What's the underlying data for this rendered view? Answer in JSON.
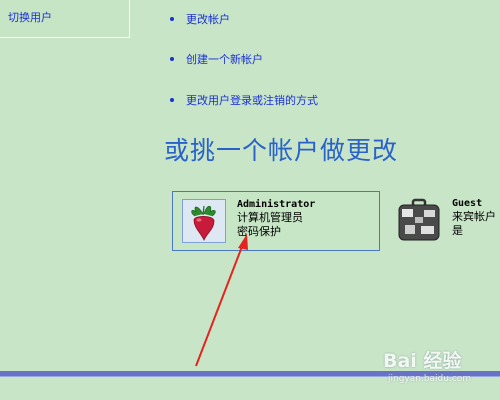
{
  "sidebar": {
    "switch_user": "切换用户"
  },
  "tasks": [
    {
      "label": "更改帐户"
    },
    {
      "label": "创建一个新帐户"
    },
    {
      "label": "更改用户登录或注销的方式"
    }
  ],
  "section": {
    "title": "或挑一个帐户做更改"
  },
  "accounts": {
    "admin": {
      "name": "Administrator",
      "type": "计算机管理员",
      "status": "密码保护",
      "icon": "radish-icon"
    },
    "guest": {
      "name": "Guest",
      "type": "来宾帐户是",
      "icon": "suitcase-icon"
    }
  },
  "watermark": {
    "brand": "Bai 经验",
    "url": "jingyan.baidu.com"
  },
  "colors": {
    "background": "#c8e6c7",
    "link": "#1a2fd6",
    "title": "#2a62c9",
    "annotation_arrow": "#e5231f"
  }
}
